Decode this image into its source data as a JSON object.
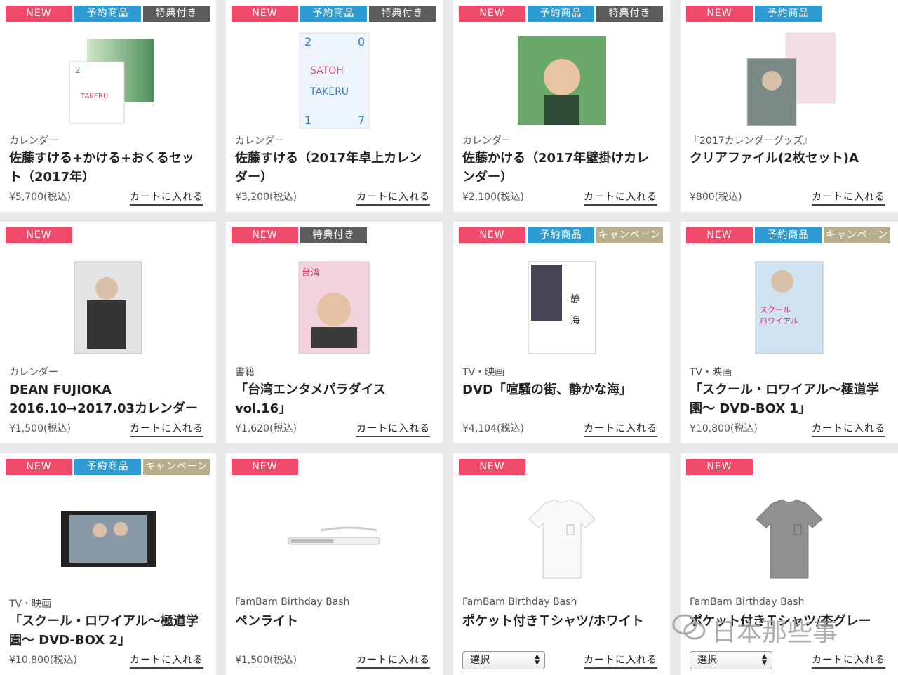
{
  "badge_labels": {
    "new": "NEW",
    "pre": "予約商品",
    "bonus": "特典付き",
    "camp": "キャンペーン"
  },
  "cart_label": "カートに入れる",
  "select_label": "選択",
  "watermark": "日本那些事",
  "products": [
    {
      "badges": [
        "new",
        "pre",
        "bonus"
      ],
      "category": "カレンダー",
      "title": "佐藤すける+かける+おくるセット（2017年）",
      "price": "¥5,700(税込)",
      "image": "calendar-set"
    },
    {
      "badges": [
        "new",
        "pre",
        "bonus"
      ],
      "category": "カレンダー",
      "title": "佐藤すける（2017年卓上カレンダー）",
      "price": "¥3,200(税込)",
      "image": "desk-calendar"
    },
    {
      "badges": [
        "new",
        "pre",
        "bonus"
      ],
      "category": "カレンダー",
      "title": "佐藤かける（2017年壁掛けカレンダー）",
      "price": "¥2,100(税込)",
      "image": "wall-calendar"
    },
    {
      "badges": [
        "new",
        "pre"
      ],
      "category": "『2017カレンダーグッズ』",
      "title": "クリアファイル(2枚セット)A",
      "price": "¥800(税込)",
      "image": "clear-file"
    },
    {
      "badges": [
        "new"
      ],
      "category": "カレンダー",
      "title": "DEAN FUJIOKA 2016.10→2017.03カレンダー",
      "price": "¥1,500(税込)",
      "image": "calendar"
    },
    {
      "badges": [
        "new",
        "bonus"
      ],
      "category": "書籍",
      "title": "「台湾エンタメパラダイスvol.16」",
      "price": "¥1,620(税込)",
      "image": "magazine"
    },
    {
      "badges": [
        "new",
        "pre",
        "camp"
      ],
      "category": "TV・映画",
      "title": "DVD「喧騒の街、静かな海」",
      "price": "¥4,104(税込)",
      "image": "dvd"
    },
    {
      "badges": [
        "new",
        "pre",
        "camp"
      ],
      "category": "TV・映画",
      "title": "「スクール・ロワイアル〜極道学園〜 DVD-BOX 1」",
      "price": "¥10,800(税込)",
      "image": "dvd-box"
    },
    {
      "badges": [
        "new",
        "pre",
        "camp"
      ],
      "category": "TV・映画",
      "title": "「スクール・ロワイアル〜極道学園〜 DVD-BOX 2」",
      "price": "¥10,800(税込)",
      "image": "dvd-still"
    },
    {
      "badges": [
        "new"
      ],
      "category": "FamBam Birthday Bash",
      "title": "ペンライト",
      "price": "¥1,500(税込)",
      "image": "penlight"
    },
    {
      "badges": [
        "new"
      ],
      "category": "FamBam Birthday Bash",
      "title": "ポケット付きＴシャツ/ホワイト",
      "price": "",
      "image": "tshirt-white",
      "has_select": true
    },
    {
      "badges": [
        "new"
      ],
      "category": "FamBam Birthday Bash",
      "title": "ポケット付きＴシャツ/杢グレー",
      "price": "",
      "image": "tshirt-grey",
      "has_select": true
    }
  ]
}
